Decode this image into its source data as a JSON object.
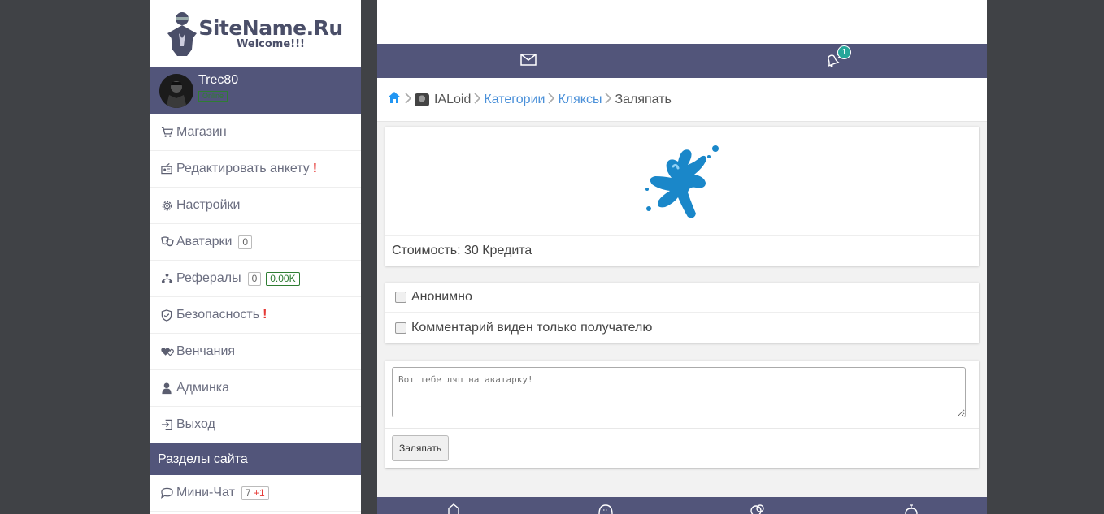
{
  "site": {
    "logo_title": "SiteName.Ru",
    "logo_subtitle": "Welcome!!!"
  },
  "user": {
    "name": "Trec80",
    "status": "Online"
  },
  "sidebar": {
    "items": [
      {
        "label": "Магазин",
        "icon": "cart-icon"
      },
      {
        "label": "Редактировать анкету",
        "icon": "profile-edit-icon",
        "alert": "!"
      },
      {
        "label": "Настройки",
        "icon": "gear-icon"
      },
      {
        "label": "Аватарки",
        "icon": "masks-icon",
        "count": "0"
      },
      {
        "label": "Рефералы",
        "icon": "referrals-icon",
        "count": "0",
        "balance": "0.00K"
      },
      {
        "label": "Безопасность",
        "icon": "shield-icon",
        "alert": "!"
      },
      {
        "label": "Венчания",
        "icon": "hearts-icon"
      },
      {
        "label": "Админка",
        "icon": "admin-icon"
      },
      {
        "label": "Выход",
        "icon": "logout-icon"
      }
    ],
    "section_header": "Разделы сайта",
    "section_items": [
      {
        "label": "Мини-Чат",
        "icon": "chat-bubble-icon",
        "count": "7",
        "new_count": "+1"
      }
    ]
  },
  "topbar": {
    "notifications_count": "1"
  },
  "breadcrumb": {
    "user": "IALoid",
    "categories": "Категории",
    "blots": "Кляксы",
    "current": "Заляпать"
  },
  "item": {
    "cost": "Стоимость: 30 Кредита",
    "image": "blue-ink-splat",
    "splat_color": "#1a87c9"
  },
  "options": {
    "anonymous": "Анонимно",
    "private_comment": "Комментарий виден только получателю"
  },
  "comment": {
    "placeholder": "Вот тебе ляп на аватарку!"
  },
  "actions": {
    "submit": "Заляпать"
  },
  "colors": {
    "accent": "#52557a",
    "link": "#4a90d9",
    "badge": "#26a69a",
    "alert": "#e53935"
  }
}
